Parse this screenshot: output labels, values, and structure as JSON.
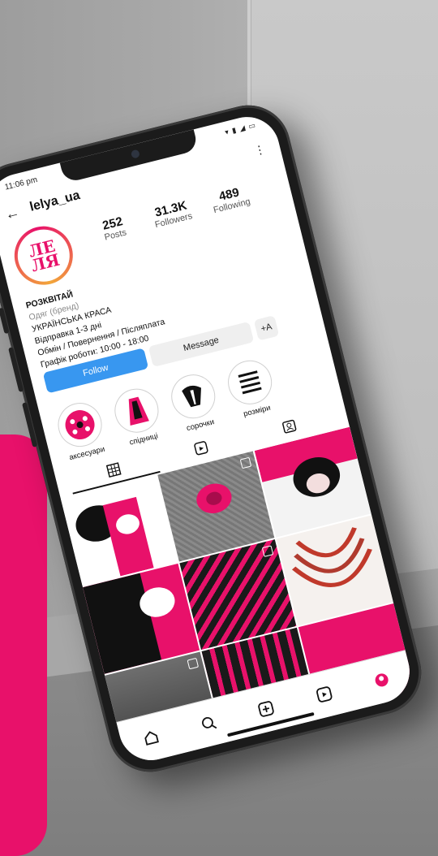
{
  "status_bar": {
    "time": "11:06 pm",
    "icons": "▾ ▮ ◢ ▭"
  },
  "header": {
    "username": "lelya_ua",
    "back_icon": "arrow-left-icon",
    "more_icon": "more-vertical-icon"
  },
  "profile": {
    "avatar_text": "ЛЕ\nЛЯ",
    "stats": [
      {
        "value": "252",
        "label": "Posts"
      },
      {
        "value": "31.3K",
        "label": "Followers"
      },
      {
        "value": "489",
        "label": "Following"
      }
    ],
    "bio": {
      "name": "РОЗКВІТАЙ",
      "category": "Одяг (бренд)",
      "lines": [
        "УКРАЇНСЬКА КРАСА",
        "Відправка 1-3 дні",
        "Обмін / Повернення / Післяплата",
        "Графік роботи: 10:00 - 18:00"
      ]
    },
    "buttons": {
      "follow": "Follow",
      "message": "Message",
      "add_user": "+A"
    }
  },
  "highlights": [
    {
      "label": "аксесуари"
    },
    {
      "label": "спідниці"
    },
    {
      "label": "сорочки"
    },
    {
      "label": "розміри"
    }
  ],
  "colors": {
    "accent": "#e8116a",
    "follow_blue": "#3897f0"
  }
}
